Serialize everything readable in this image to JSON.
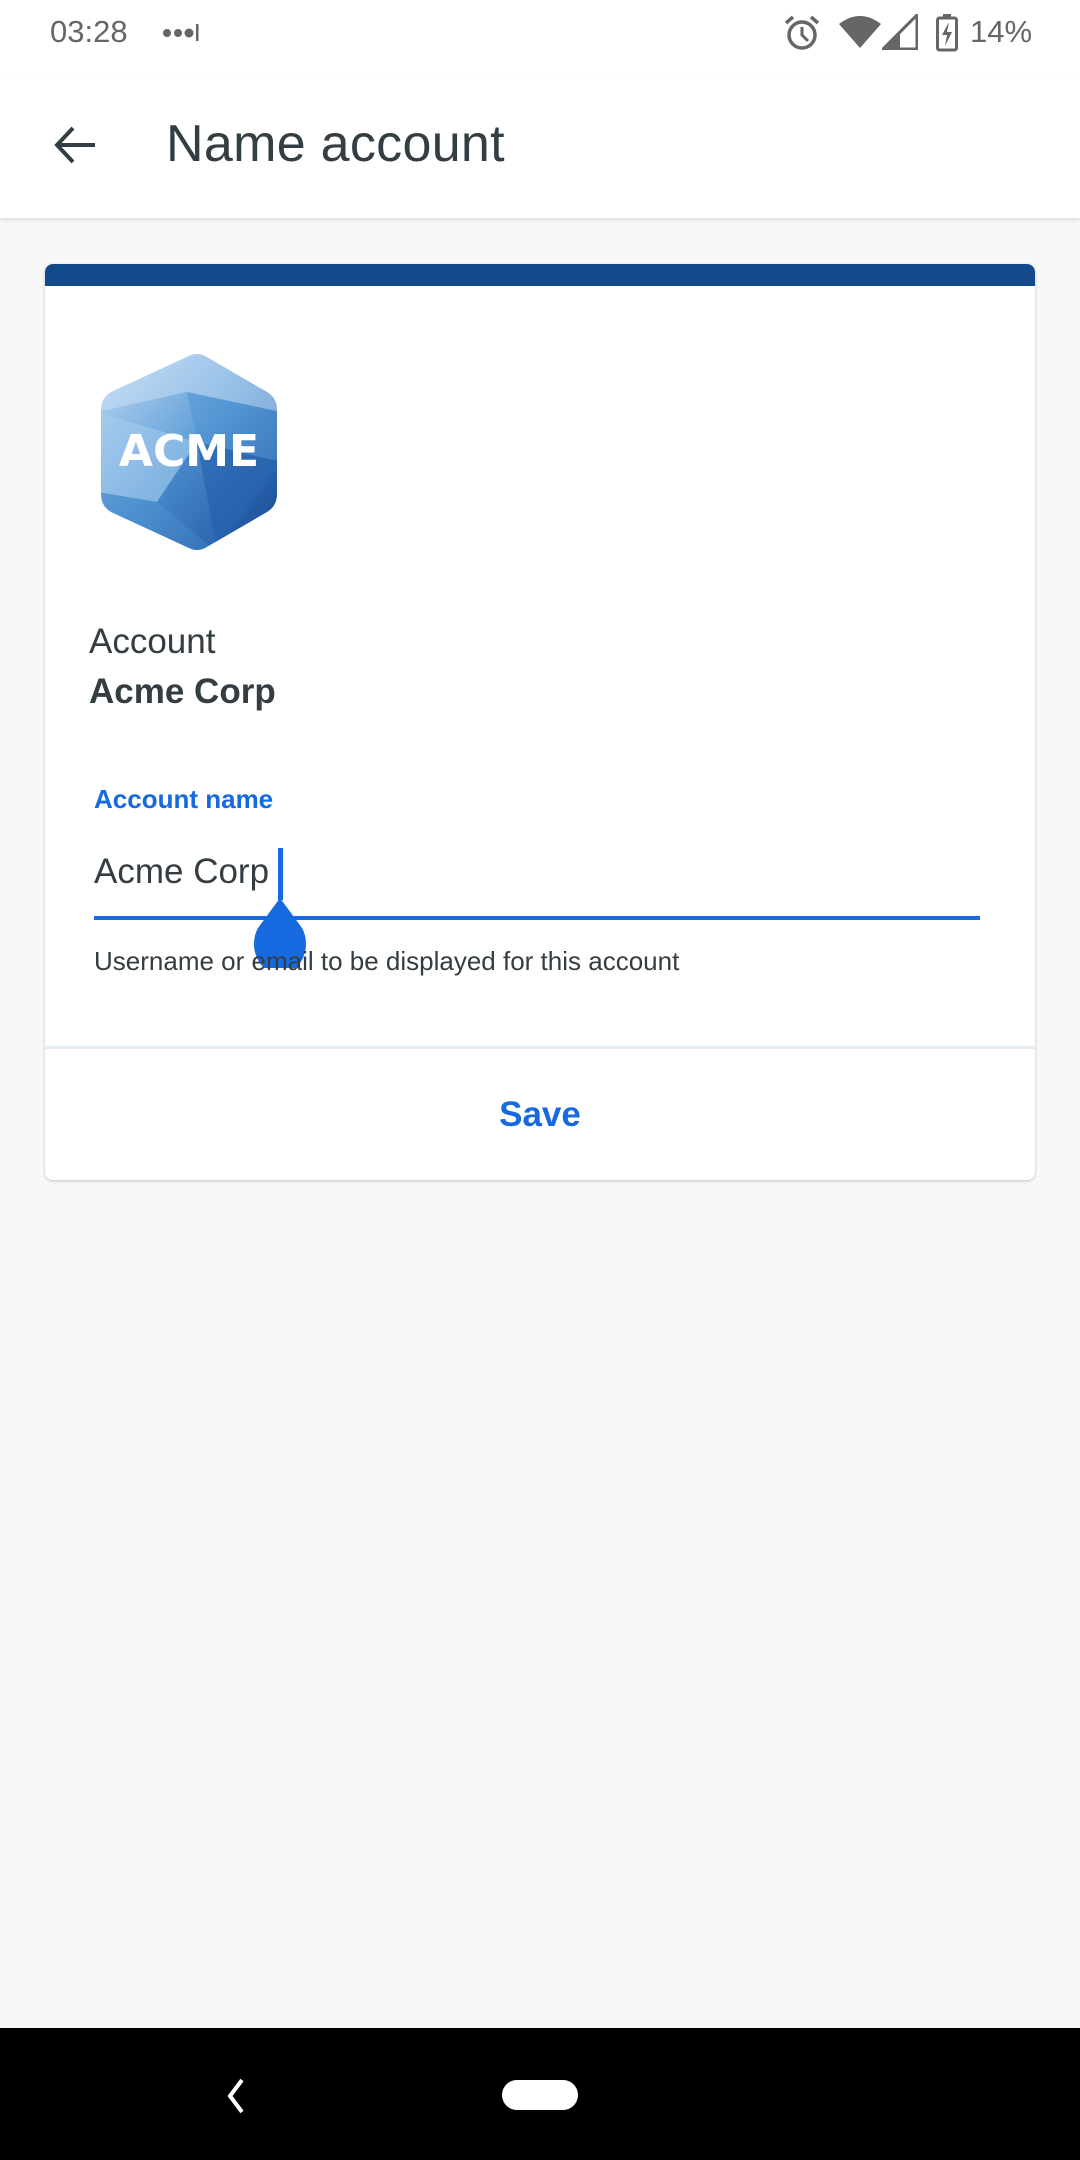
{
  "status_bar": {
    "time": "03:28",
    "notification_icon": "more-dots-icon",
    "icons": [
      "alarm-icon",
      "wifi-icon",
      "cell-signal-icon",
      "battery-charging-icon"
    ],
    "battery_percent": "14%"
  },
  "app_bar": {
    "back_icon": "arrow-back-icon",
    "title": "Name account"
  },
  "card": {
    "accent_color": "#124a8c",
    "logo": {
      "icon": "acme-logo-icon",
      "text": "ACME"
    },
    "account_label": "Account",
    "account_value": "Acme Corp",
    "field": {
      "label": "Account name",
      "value": "Acme Corp",
      "helper": "Username or email to be displayed for this account",
      "focused": true
    },
    "save_label": "Save"
  },
  "colors": {
    "primary": "#1769e0",
    "text": "#343d42",
    "background": "#f8f8f8"
  },
  "nav_bar": {
    "back_icon": "nav-back-icon",
    "home_icon": "nav-home-pill-icon"
  }
}
